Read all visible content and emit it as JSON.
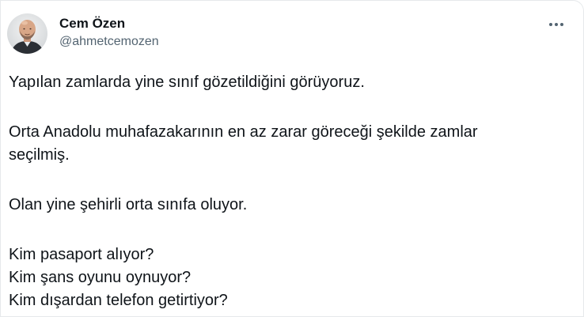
{
  "author": {
    "display_name": "Cem Özen",
    "handle": "@ahmetcemozen",
    "avatar_icon": "user-avatar-photo"
  },
  "more_icon": "more-options-icon",
  "tweet": {
    "paragraphs": [
      "Yapılan zamlarda yine sınıf gözetildiğini görüyoruz.",
      "Orta Anadolu muhafazakarının en az zarar göreceği şekilde zamlar\nseçilmiş.",
      "Olan yine şehirli orta sınıfa oluyor.",
      "Kim pasaport alıyor?\nKim şans oyunu oynuyor?\nKim dışardan telefon getirtiyor?"
    ]
  },
  "colors": {
    "text": "#0f1419",
    "secondary": "#536471",
    "border": "#e6e9eb"
  }
}
